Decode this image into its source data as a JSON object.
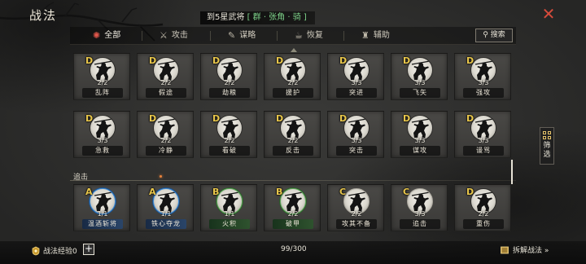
{
  "window": {
    "title": "战法",
    "close_glyph": "✕"
  },
  "notice": {
    "prefix": "到5星武将",
    "highlight": "[ 群 · 张角 · 骑 ]"
  },
  "tabs": [
    {
      "label": "全部",
      "icon": "burst-icon",
      "active": true
    },
    {
      "label": "攻击",
      "icon": "crossed-swords-icon",
      "active": false
    },
    {
      "label": "谋略",
      "icon": "scroll-icon",
      "active": false
    },
    {
      "label": "恢复",
      "icon": "teapot-icon",
      "active": false
    },
    {
      "label": "辅助",
      "icon": "pouch-icon",
      "active": false
    }
  ],
  "search": {
    "label": "搜索",
    "icon": "search-icon"
  },
  "filter": {
    "label": "筛选",
    "icon": "grid-icon"
  },
  "sections": {
    "pursuit_label": "追击"
  },
  "skills_row1": [
    {
      "grade": "D",
      "count": "2/2",
      "name": "乱阵"
    },
    {
      "grade": "D",
      "count": "2/2",
      "name": "假途"
    },
    {
      "grade": "D",
      "count": "2/2",
      "name": "劫粮"
    },
    {
      "grade": "D",
      "count": "2/2",
      "name": "援护"
    },
    {
      "grade": "D",
      "count": "3/3",
      "name": "突进"
    },
    {
      "grade": "D",
      "count": "3/3",
      "name": "飞矢"
    },
    {
      "grade": "D",
      "count": "3/3",
      "name": "强攻"
    }
  ],
  "skills_row2": [
    {
      "grade": "D",
      "count": "3/3",
      "name": "急救"
    },
    {
      "grade": "D",
      "count": "2/2",
      "name": "冷静"
    },
    {
      "grade": "D",
      "count": "2/2",
      "name": "看破"
    },
    {
      "grade": "D",
      "count": "2/2",
      "name": "反击"
    },
    {
      "grade": "D",
      "count": "3/3",
      "name": "突击"
    },
    {
      "grade": "D",
      "count": "3/3",
      "name": "谋攻"
    },
    {
      "grade": "D",
      "count": "3/3",
      "name": "谩骂"
    }
  ],
  "skills_row3": [
    {
      "grade": "A",
      "count": "1/1",
      "name": "温酒斩将",
      "rarity": "A"
    },
    {
      "grade": "A",
      "count": "1/1",
      "name": "铁心夺龙",
      "rarity": "A"
    },
    {
      "grade": "B",
      "count": "1/1",
      "name": "火积",
      "rarity": "B"
    },
    {
      "grade": "B",
      "count": "2/2",
      "name": "破甲",
      "rarity": "B"
    },
    {
      "grade": "C",
      "count": "2/2",
      "name": "攻其不备",
      "rarity": "C"
    },
    {
      "grade": "C",
      "count": "3/3",
      "name": "追击",
      "rarity": "C"
    },
    {
      "grade": "D",
      "count": "2/2",
      "name": "重伤",
      "rarity": "D"
    }
  ],
  "footer": {
    "exp_label": "战法经验0",
    "plus": "+",
    "count": "99/300",
    "disassemble": "拆解战法 »"
  },
  "colors": {
    "accent_red": "#d64b3b",
    "grade_gold": "#e8c64a",
    "highlight_green": "#7ed38a",
    "rarity_A": "#3f8cd6",
    "rarity_B": "#5fa85a"
  }
}
